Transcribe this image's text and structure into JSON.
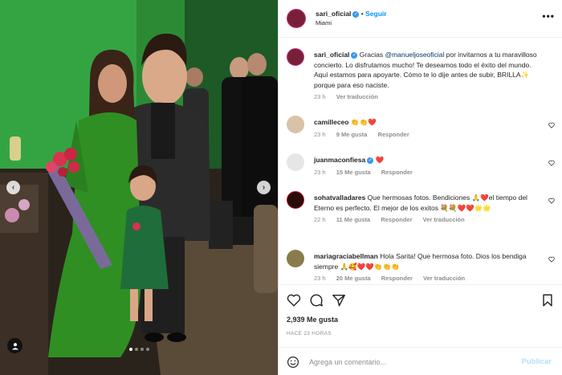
{
  "post": {
    "author": "sari_oficial",
    "location": "Miami",
    "follow_label": "Seguir",
    "more_label": "•••",
    "caption": {
      "username": "sari_oficial",
      "text_before": "Gracias ",
      "mention": "@manueljoseoficial",
      "text_after": " por invitarnos a tu maravilloso concierto. Lo disfrutamos mucho! Te deseamos todo el éxito del mundo. Aquí estamos para apoyarte. Cómo te lo dije antes de subir, BRILLA✨ porque para eso naciste.",
      "time": "23 h",
      "translation": "Ver traducción"
    },
    "comments": [
      {
        "username": "camilleceo",
        "text": "👏👏❤️",
        "time": "23 h",
        "likes": "9 Me gusta",
        "reply": "Responder",
        "translation": ""
      },
      {
        "username": "juanmaconfiesa",
        "text": "❤️",
        "time": "23 h",
        "likes": "15 Me gusta",
        "reply": "Responder",
        "translation": ""
      },
      {
        "username": "sohatvalladares",
        "text": "Que hermosas fotos. Bendiciones 🙏❤️el tiempo del Eterno es perfecto. El mejor de los exitos 💐💐❤️❤️🌟🌟",
        "time": "22 h",
        "likes": "11 Me gusta",
        "reply": "Responder",
        "translation": "Ver traducción"
      },
      {
        "username": "mariagraciabellman",
        "text": "Hola Sarita! Que hermosa foto. Dios los bendiga siempre 🙏🥰❤️❤️👏👏👏",
        "time": "23 h",
        "likes": "20 Me gusta",
        "reply": "Responder",
        "translation": "Ver traducción"
      }
    ],
    "likes_count": "2,939 Me gusta",
    "posted_ago": "HACE 23 HORAS",
    "composer": {
      "placeholder": "Agrega un comentario...",
      "post_label": "Publicar"
    },
    "carousel": {
      "slide_count": 4,
      "active_slide": 1
    }
  },
  "colors": {
    "accent": "#0095f6",
    "verified": "#3897f0",
    "muted": "#8e8e8e",
    "green_wall": "#2f9e3a",
    "dress_green": "#2f8f22"
  },
  "icons": [
    "verified-icon",
    "heart-icon",
    "comment-icon",
    "share-icon",
    "bookmark-icon",
    "emoji-icon",
    "chevron-left-icon",
    "chevron-right-icon",
    "user-tag-icon"
  ]
}
